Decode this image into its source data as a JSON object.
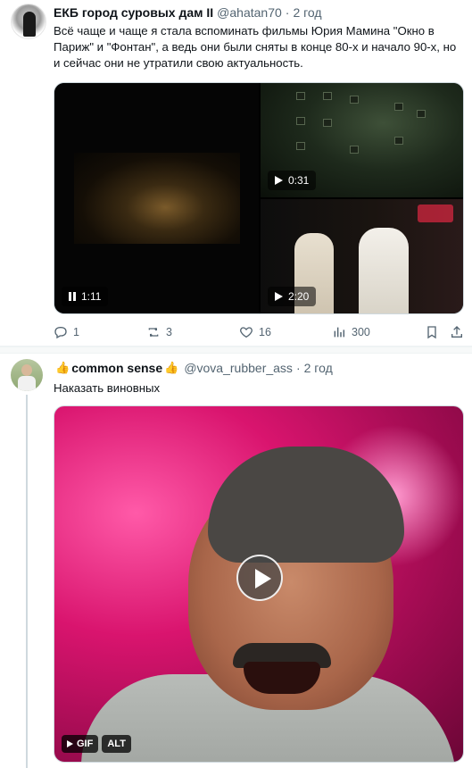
{
  "tweet1": {
    "name": "ЕКБ город суровых дам II",
    "handle": "@ahatan70",
    "time": "2 год",
    "text": "Всё чаще и чаще я стала вспоминать фильмы Юрия Мамина \"Окно в Париж\" и \"Фонтан\", а ведь они были сняты в конце 80-х и начало 90-х, но и сейчас они не утратили свою актуальность.",
    "videos": [
      {
        "duration": "1:11",
        "state": "playing"
      },
      {
        "duration": "0:31",
        "state": "paused"
      },
      {
        "duration": "2:20",
        "state": "paused"
      }
    ],
    "actions": {
      "replies": "1",
      "reposts": "3",
      "likes": "16",
      "views": "300"
    }
  },
  "tweet2": {
    "name": "common sense",
    "emoji": "👍",
    "handle": "@vova_rubber_ass",
    "time": "2 год",
    "text": "Наказать виновных",
    "gif_labels": {
      "gif": "GIF",
      "alt": "ALT"
    }
  },
  "colors": {
    "text": "#0f1419",
    "secondary": "#536471",
    "border": "#cfd9de"
  }
}
